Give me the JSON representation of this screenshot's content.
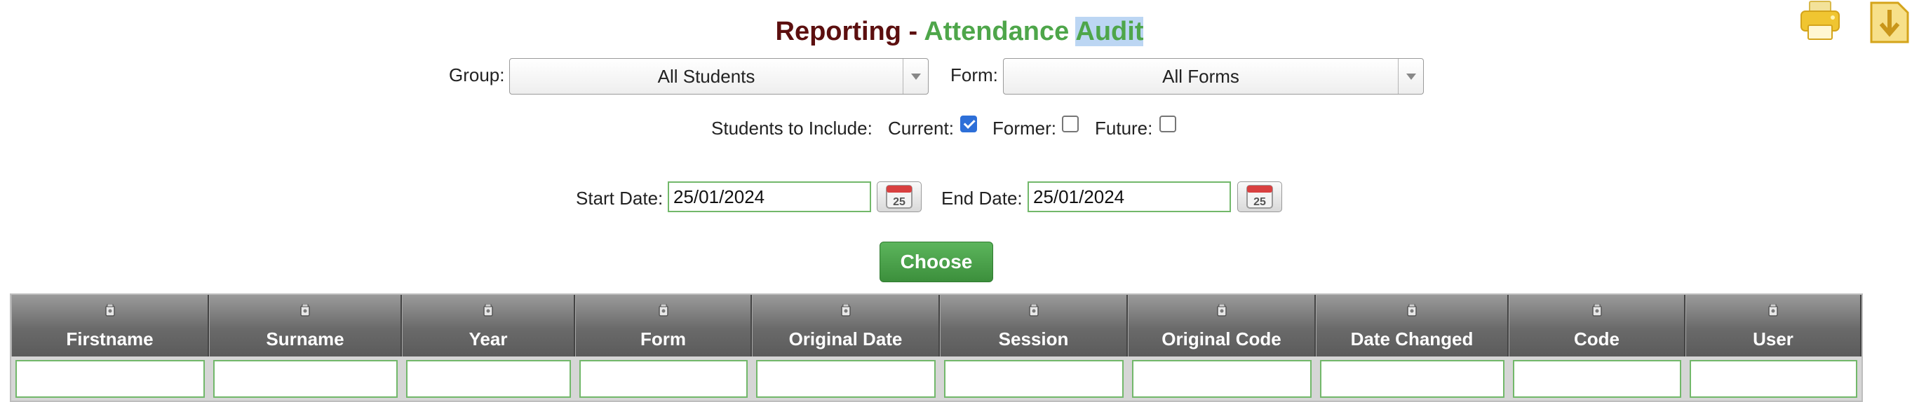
{
  "title": {
    "prefix": "Reporting - ",
    "part1": "Attendance",
    "part2": "Audit"
  },
  "icons": {
    "print": "printer-icon",
    "export": "export-download-icon",
    "calendar": "calendar-icon",
    "column_filter": "filter-icon"
  },
  "colors": {
    "title_dark": "#5c0f0f",
    "title_green": "#4ea64a",
    "button_green": "#4ea64a",
    "input_border": "#72b86a",
    "header_grey": "#6a6a6a"
  },
  "filters": {
    "group_label": "Group:",
    "group_value": "All Students",
    "form_label": "Form:",
    "form_value": "All Forms",
    "include_label": "Students to Include:",
    "current_label": "Current:",
    "current_checked": true,
    "former_label": "Former:",
    "former_checked": false,
    "future_label": "Future:",
    "future_checked": false,
    "start_label": "Start Date:",
    "start_value": "25/01/2024",
    "calendar_day": "25",
    "end_label": "End Date:",
    "end_value": "25/01/2024"
  },
  "choose_label": "Choose",
  "table": {
    "columns": [
      "Firstname",
      "Surname",
      "Year",
      "Form",
      "Original Date",
      "Session",
      "Original Code",
      "Date Changed",
      "Code",
      "User"
    ]
  }
}
